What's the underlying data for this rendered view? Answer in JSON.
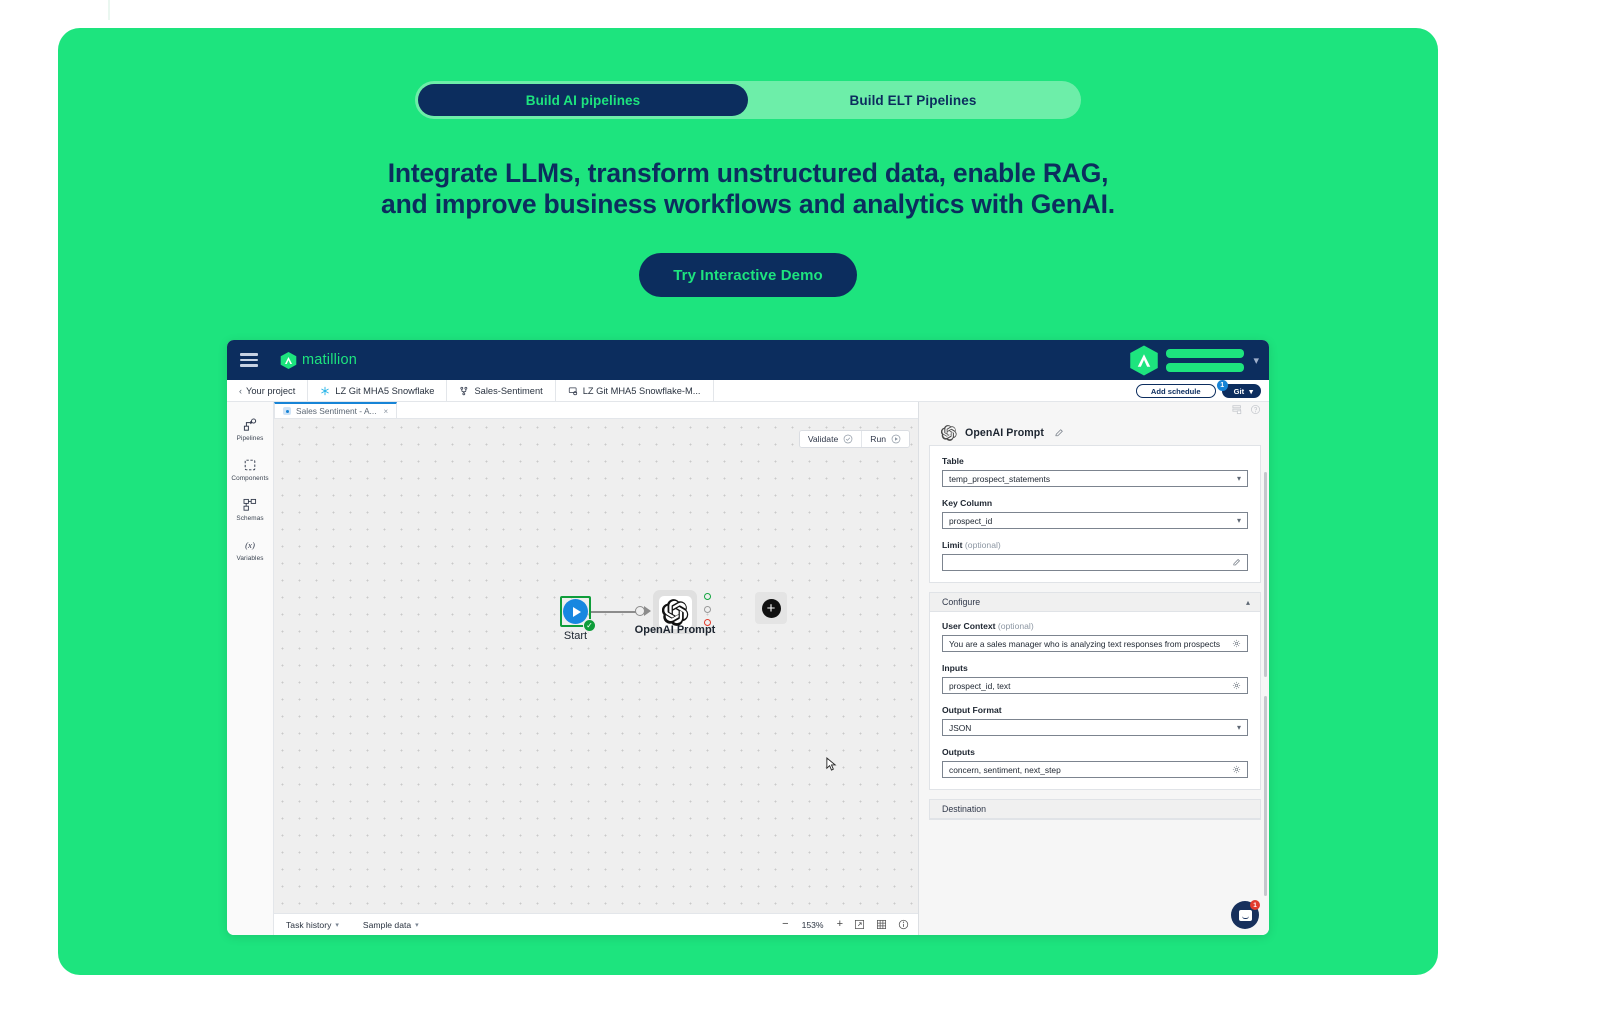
{
  "hero": {
    "toggle": {
      "active_label": "Build AI pipelines",
      "inactive_label": "Build ELT Pipelines"
    },
    "headline_line1": "Integrate LLMs, transform unstructured data, enable RAG,",
    "headline_line2": "and improve business workflows and analytics with GenAI.",
    "cta_label": "Try Interactive Demo",
    "colors": {
      "green": "#1DE47E",
      "green_light": "#6DEEA9",
      "navy": "#0C2D5E"
    }
  },
  "app": {
    "brand": "matillion",
    "menu_icon": "hamburger-icon",
    "breadcrumbs": [
      {
        "label": "Your project",
        "icon": "chevron-left-icon"
      },
      {
        "label": "LZ Git MHA5 Snowflake",
        "icon": "snowflake-icon"
      },
      {
        "label": "Sales-Sentiment",
        "icon": "branch-icon"
      },
      {
        "label": "LZ Git MHA5 Snowflake-M...",
        "icon": "environment-icon"
      }
    ],
    "header_actions": {
      "add_schedule": "Add schedule",
      "git_label": "Git",
      "git_badge": "1",
      "git_chevron": "chevron-down-icon"
    },
    "sidebar": [
      {
        "label": "Pipelines",
        "icon": "pipelines-icon"
      },
      {
        "label": "Components",
        "icon": "components-icon"
      },
      {
        "label": "Schemas",
        "icon": "schemas-icon"
      },
      {
        "label": "Variables",
        "icon": "variables-icon"
      }
    ],
    "tab": {
      "label": "Sales Sentiment - A...",
      "close": "×"
    },
    "canvas_actions": [
      {
        "label": "Validate",
        "icon": "check-circle-icon"
      },
      {
        "label": "Run",
        "icon": "play-circle-icon"
      }
    ],
    "nodes": [
      {
        "label": "Start",
        "type": "start-node"
      },
      {
        "label": "OpenAI Prompt",
        "type": "openai-node"
      }
    ],
    "add_node_label": "+",
    "bottom_bar": {
      "items": [
        {
          "label": "Task history"
        },
        {
          "label": "Sample data"
        }
      ],
      "zoom_out": "−",
      "zoom_level": "153%",
      "zoom_in": "+",
      "fit_icon": "fit-screen-icon",
      "grid_icon": "grid-icon",
      "info_icon": "info-icon"
    },
    "panel": {
      "title": "OpenAI Prompt",
      "edit_icon": "pencil-icon",
      "fields": [
        {
          "label": "Table",
          "optional": "",
          "value": "temp_prospect_statements",
          "control": "select"
        },
        {
          "label": "Key Column",
          "optional": "",
          "value": "prospect_id",
          "control": "select"
        },
        {
          "label": "Limit",
          "optional": "(optional)",
          "value": "",
          "control": "text-editor"
        }
      ],
      "configure": {
        "title": "Configure",
        "caret": "chevron-up-icon",
        "fields": [
          {
            "label": "User Context",
            "optional": "(optional)",
            "value": "You are a sales manager who is analyzing text responses from prospects",
            "control": "gear"
          },
          {
            "label": "Inputs",
            "optional": "",
            "value": "prospect_id, text",
            "control": "gear"
          },
          {
            "label": "Output Format",
            "optional": "",
            "value": "JSON",
            "control": "select"
          },
          {
            "label": "Outputs",
            "optional": "",
            "value": "concern, sentiment, next_step",
            "control": "gear"
          }
        ]
      },
      "destination": {
        "title": "Destination"
      }
    },
    "chat": {
      "badge": "1",
      "icon": "chat-icon"
    }
  }
}
